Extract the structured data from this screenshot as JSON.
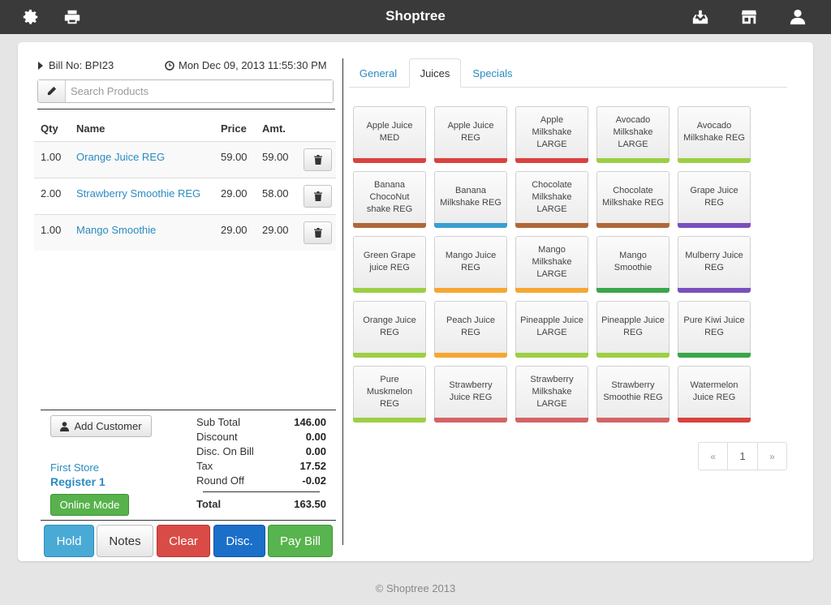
{
  "header": {
    "title": "Shoptree",
    "icons": [
      "gear-icon",
      "printer-icon",
      "inbox-download-icon",
      "store-icon",
      "user-icon"
    ]
  },
  "bill": {
    "bill_no": "Bill No: BPI23",
    "datetime": "Mon Dec 09, 2013 11:55:30 PM"
  },
  "search": {
    "placeholder": "Search Products"
  },
  "table": {
    "headers": {
      "qty": "Qty",
      "name": "Name",
      "price": "Price",
      "amt": "Amt."
    },
    "rows": [
      {
        "qty": "1.00",
        "name": "Orange Juice REG",
        "price": "59.00",
        "amt": "59.00"
      },
      {
        "qty": "2.00",
        "name": "Strawberry Smoothie REG",
        "price": "29.00",
        "amt": "58.00"
      },
      {
        "qty": "1.00",
        "name": "Mango Smoothie",
        "price": "29.00",
        "amt": "29.00"
      }
    ]
  },
  "customer": {
    "add_label": "Add Customer",
    "store": "First Store",
    "register": "Register 1",
    "mode": "Online Mode"
  },
  "totals": {
    "sub_total_label": "Sub Total",
    "sub_total": "146.00",
    "discount_label": "Discount",
    "discount": "0.00",
    "disc_on_bill_label": "Disc. On Bill",
    "disc_on_bill": "0.00",
    "tax_label": "Tax",
    "tax": "17.52",
    "round_off_label": "Round Off",
    "round_off": "-0.02",
    "total_label": "Total",
    "total": "163.50"
  },
  "actions": {
    "hold": "Hold",
    "notes": "Notes",
    "clear": "Clear",
    "disc": "Disc.",
    "pay": "Pay Bill"
  },
  "tabs": [
    {
      "label": "General"
    },
    {
      "label": "Juices"
    },
    {
      "label": "Specials"
    }
  ],
  "products": [
    {
      "label": "Apple Juice MED",
      "color": "#d9433f"
    },
    {
      "label": "Apple Juice REG",
      "color": "#d9433f"
    },
    {
      "label": "Apple Milkshake LARGE",
      "color": "#d9433f"
    },
    {
      "label": "Avocado Milkshake LARGE",
      "color": "#9dcf45"
    },
    {
      "label": "Avocado Milkshake REG",
      "color": "#9dcf45"
    },
    {
      "label": "Banana ChocoNut shake REG",
      "color": "#b0683a"
    },
    {
      "label": "Banana Milkshake REG",
      "color": "#3a9fcf"
    },
    {
      "label": "Chocolate Milkshake LARGE",
      "color": "#b0683a"
    },
    {
      "label": "Chocolate Milkshake REG",
      "color": "#b0683a"
    },
    {
      "label": "Grape Juice REG",
      "color": "#7a4fbd"
    },
    {
      "label": "Green Grape juice REG",
      "color": "#9dcf45"
    },
    {
      "label": "Mango Juice REG",
      "color": "#f5a733"
    },
    {
      "label": "Mango Milkshake LARGE",
      "color": "#f5a733"
    },
    {
      "label": "Mango Smoothie",
      "color": "#3aa64a"
    },
    {
      "label": "Mulberry Juice REG",
      "color": "#7a4fbd"
    },
    {
      "label": "Orange Juice REG",
      "color": "#9dcf45"
    },
    {
      "label": "Peach Juice REG",
      "color": "#f5a733"
    },
    {
      "label": "Pineapple Juice LARGE",
      "color": "#9dcf45"
    },
    {
      "label": "Pineapple Juice REG",
      "color": "#9dcf45"
    },
    {
      "label": "Pure Kiwi Juice REG",
      "color": "#3aa64a"
    },
    {
      "label": "Pure Muskmelon REG",
      "color": "#9dcf45"
    },
    {
      "label": "Strawberry Juice REG",
      "color": "#d46466"
    },
    {
      "label": "Strawberry Milkshake LARGE",
      "color": "#d46466"
    },
    {
      "label": "Strawberry Smoothie REG",
      "color": "#d46466"
    },
    {
      "label": "Watermelon Juice REG",
      "color": "#d9433f"
    }
  ],
  "pagination": {
    "prev": "«",
    "page": "1",
    "next": "»"
  },
  "colors": {
    "hold": "#4aaad6",
    "clear": "#d94b47",
    "disc": "#1a6fc9",
    "pay": "#58b44e",
    "link": "#2a8bc0"
  },
  "footer": {
    "text": "© Shoptree 2013"
  }
}
